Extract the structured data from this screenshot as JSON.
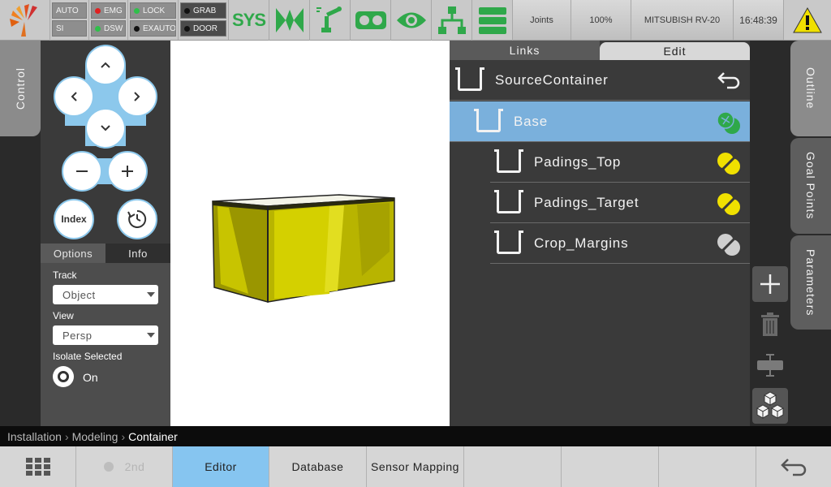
{
  "topbar": {
    "status": {
      "auto": "AUTO",
      "si": "SI",
      "emg": "EMG",
      "dsw": "DSW",
      "lock": "LOCK",
      "exauto": "EXAUTO",
      "grab": "GRAB",
      "door": "DOOR"
    },
    "sys_label": "SYS",
    "joints_label": "Joints",
    "speed": "100%",
    "robot": "MITSUBISH RV-20",
    "time": "16:48:39",
    "colors": {
      "green": "#2fa84a",
      "warning": "#f0e000",
      "red": "#e02020"
    }
  },
  "left_tab": {
    "label": "Control"
  },
  "controls": {
    "up_icon": "chevron-up",
    "down_icon": "chevron-down",
    "left_icon": "chevron-left",
    "right_icon": "chevron-right",
    "zoom_out_icon": "minus",
    "zoom_in_icon": "plus",
    "index_label": "Index",
    "reset_icon": "rotate-reset"
  },
  "options": {
    "tabs": [
      "Options",
      "Info"
    ],
    "track_label": "Track",
    "track_value": "Object",
    "view_label": "View",
    "view_value": "Persp",
    "isolate_label": "Isolate Selected",
    "isolate_value": "On"
  },
  "tree": {
    "tabs": [
      "Links",
      "Edit"
    ],
    "items": [
      {
        "label": "SourceContainer",
        "icon": "back-arrow-icon"
      },
      {
        "label": "Base",
        "icon": "collision-icon"
      },
      {
        "label": "Padings_Top",
        "icon": "visibility-yellow-icon"
      },
      {
        "label": "Padings_Target",
        "icon": "visibility-yellow-icon"
      },
      {
        "label": "Crop_Margins",
        "icon": "visibility-off-icon"
      }
    ],
    "selected_color": "#7ab0dc"
  },
  "right_tabs": [
    "Outline",
    "Goal Points",
    "Parameters"
  ],
  "breadcrumb": {
    "items": [
      "Installation",
      "Modeling"
    ],
    "current": "Container"
  },
  "bottombar": {
    "second_label": "2nd",
    "editor_label": "Editor",
    "database_label": "Database",
    "sensor_label": "Sensor Mapping"
  }
}
